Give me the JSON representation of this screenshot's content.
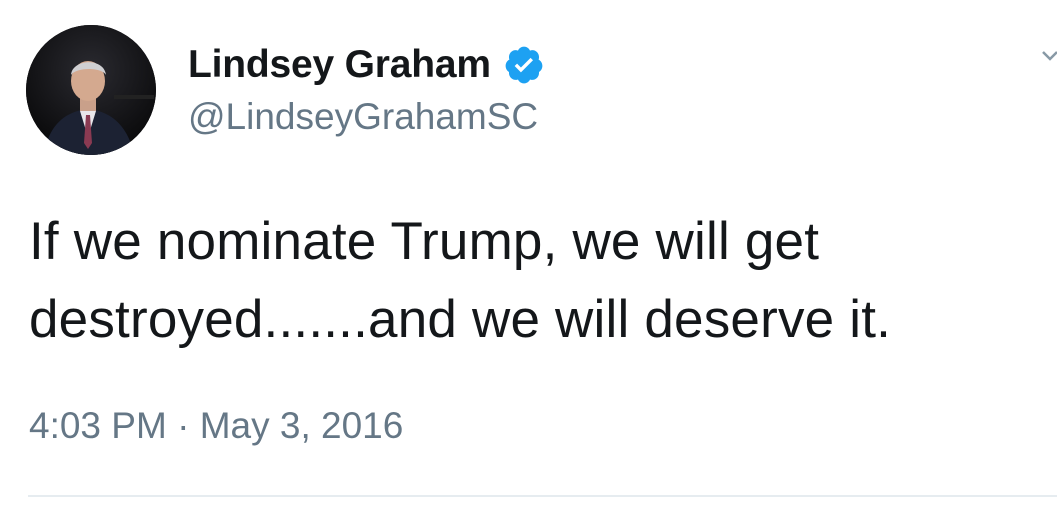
{
  "author": {
    "display_name": "Lindsey Graham",
    "handle": "@LindseyGrahamSC",
    "verified": true
  },
  "tweet": {
    "text": "If we nominate Trump, we will get destroyed.......and we will deserve it.",
    "time": "4:03 PM",
    "separator": "·",
    "date": "May 3, 2016"
  },
  "colors": {
    "text_primary": "#14171a",
    "text_secondary": "#657786",
    "verified_blue": "#1da1f2",
    "divider": "#e6ecf0"
  },
  "icons": {
    "verified": "verified-badge-icon",
    "menu": "chevron-down-icon"
  }
}
